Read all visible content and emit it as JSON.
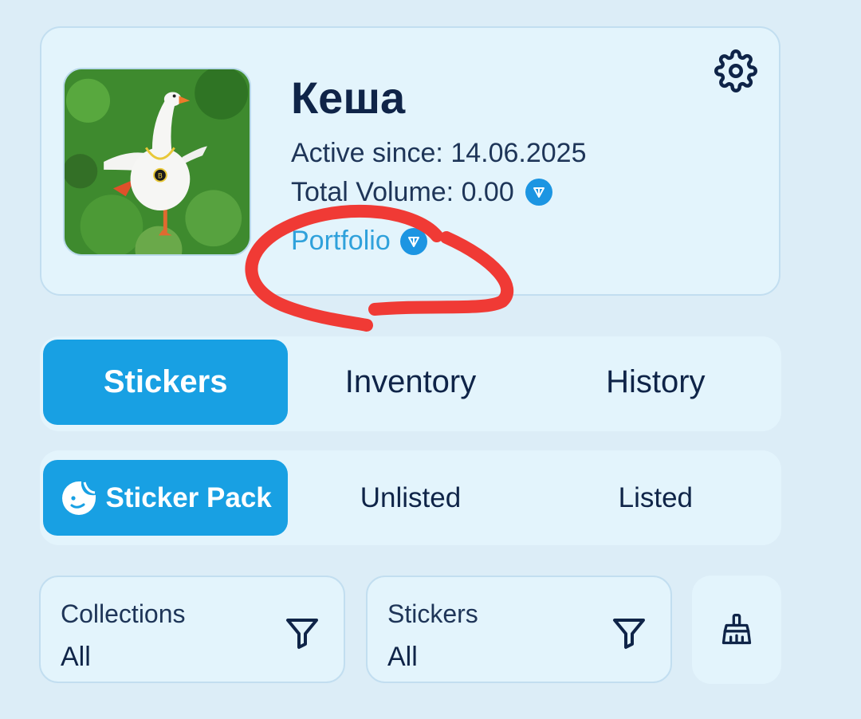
{
  "profile": {
    "name": "Кеша",
    "active_since_label": "Active since:",
    "active_since_value": "14.06.2025",
    "total_volume_label": "Total Volume:",
    "total_volume_value": "0.00",
    "portfolio_label": "Portfolio",
    "currency_icon": "ton-icon",
    "settings_icon": "gear-icon"
  },
  "main_tabs": [
    {
      "label": "Stickers",
      "selected": true
    },
    {
      "label": "Inventory",
      "selected": false
    },
    {
      "label": "History",
      "selected": false
    }
  ],
  "sub_tabs": [
    {
      "label": "Sticker Pack",
      "selected": true,
      "icon": "sticker-icon"
    },
    {
      "label": "Unlisted",
      "selected": false
    },
    {
      "label": "Listed",
      "selected": false
    }
  ],
  "filters": {
    "collections": {
      "label": "Collections",
      "value": "All",
      "icon": "funnel-icon"
    },
    "stickers": {
      "label": "Stickers",
      "value": "All",
      "icon": "funnel-icon"
    },
    "clear_icon": "broom-icon"
  },
  "colors": {
    "accent": "#18a0e3",
    "link": "#2fa1db",
    "annotation": "#f03a35",
    "background": "#dcedf7",
    "card": "#e3f4fc"
  }
}
